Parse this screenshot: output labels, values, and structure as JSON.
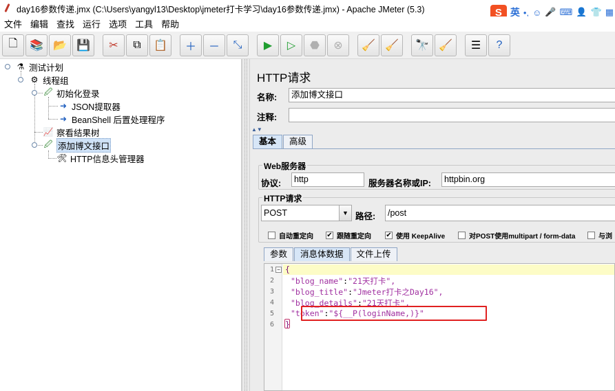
{
  "window": {
    "title": "day16参数传递.jmx (C:\\Users\\yangyl13\\Desktop\\jmeter打卡学习\\day16参数传递.jmx) - Apache JMeter (5.3)"
  },
  "ime": {
    "logo": "S",
    "lang": "英",
    "punct": "•,",
    "icons": [
      "smile-icon",
      "mic-icon",
      "keyboard-icon",
      "user-icon",
      "shirt-icon",
      "grid-icon"
    ]
  },
  "menu": [
    "文件",
    "编辑",
    "查找",
    "运行",
    "选项",
    "工具",
    "帮助"
  ],
  "toolbar": {
    "buttons": [
      "new",
      "templates",
      "open",
      "save",
      "cut",
      "copy",
      "paste",
      "expand",
      "collapse",
      "toggle",
      "start",
      "start-no-pause",
      "stop",
      "shutdown",
      "clear",
      "clear-all",
      "search",
      "reset-search",
      "function-helper",
      "help"
    ]
  },
  "tree": {
    "items": [
      {
        "label": "测试计划",
        "icon": "test-plan-icon"
      },
      {
        "label": "线程组",
        "icon": "thread-group-icon"
      },
      {
        "label": "初始化登录",
        "icon": "sampler-icon"
      },
      {
        "label": "JSON提取器",
        "icon": "extractor-icon"
      },
      {
        "label": "BeanShell 后置处理程序",
        "icon": "postprocessor-icon"
      },
      {
        "label": "察看结果树",
        "icon": "listener-icon"
      },
      {
        "label": "添加博文接口",
        "icon": "sampler-icon"
      },
      {
        "label": "HTTP信息头管理器",
        "icon": "config-icon"
      }
    ]
  },
  "panel": {
    "title": "HTTP请求",
    "name_label": "名称:",
    "name_value": "添加博文接口",
    "comment_label": "注释:",
    "comment_value": "",
    "tabs": [
      "基本",
      "高级"
    ],
    "web_server_group": "Web服务器",
    "protocol_label": "协议:",
    "protocol_value": "http",
    "server_label": "服务器名称或IP:",
    "server_value": "httpbin.org",
    "http_request_group": "HTTP请求",
    "method_value": "POST",
    "path_label": "路径:",
    "path_value": "/post",
    "checkboxes": [
      {
        "label": "自动重定向",
        "checked": false
      },
      {
        "label": "跟随重定向",
        "checked": true
      },
      {
        "label": "使用 KeepAlive",
        "checked": true
      },
      {
        "label": "对POST使用multipart / form-data",
        "checked": false
      },
      {
        "label": "与浏",
        "checked": false
      }
    ],
    "body_tabs": [
      "参数",
      "消息体数据",
      "文件上传"
    ]
  },
  "editor": {
    "line_numbers": [
      "1",
      "2",
      "3",
      "4",
      "5",
      "6"
    ],
    "lines": {
      "l1": "{",
      "l2_key": "\"blog_name\"",
      "l2_val": "\"21天打卡\",",
      "l3_key": "\"blog_title\"",
      "l3_val": "\"Jmeter打卡之Day16\",",
      "l4_key": "\"blog_details\"",
      "l4_val": "\"21天打卡\",",
      "l5_key": "\"token\"",
      "l5_val": "\"${__P(loginName,)}\"",
      "l6": "}"
    }
  }
}
